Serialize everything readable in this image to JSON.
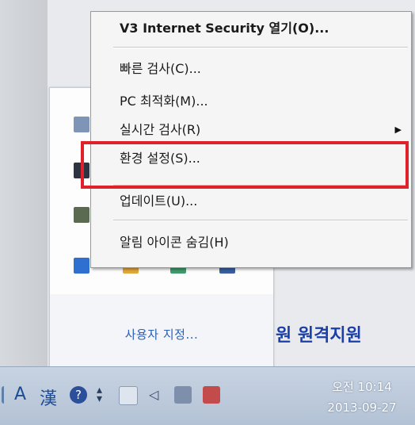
{
  "menu": {
    "open_label": "V3 Internet Security 열기(O)...",
    "quick_scan": "빠른 검사(C)...",
    "pc_optimize": "PC 최적화(M)...",
    "realtime_scan": "실시간 검사(R)",
    "settings": "환경 설정(S)...",
    "update": "업데이트(U)...",
    "hide_icon": "알림 아이콘 숨김(H)"
  },
  "tray_panel": {
    "customize_label": "사용자 지정..."
  },
  "background_text": "원 원격지원",
  "taskbar": {
    "ime_a": "A",
    "ime_han": "漢",
    "clock_time": "오전 10:14",
    "clock_date": "2013-09-27"
  },
  "colors": {
    "highlight": "#e0202a",
    "link_blue": "#2b5fb8",
    "taskbar_top": "#c7d3e2"
  }
}
